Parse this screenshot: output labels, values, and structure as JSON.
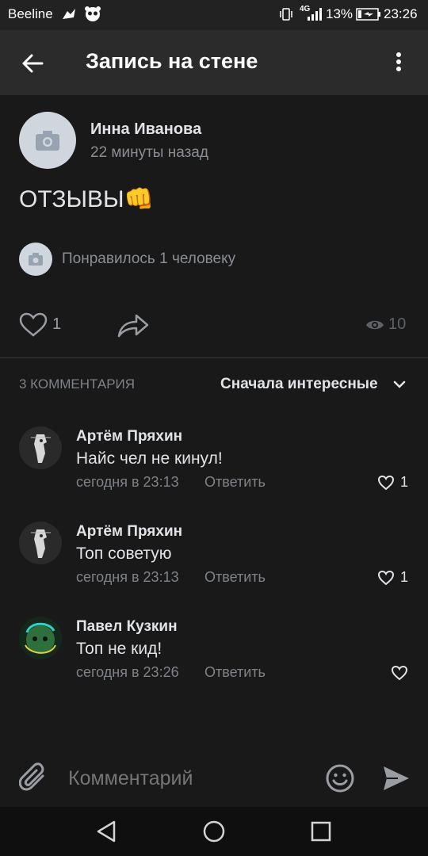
{
  "status_bar": {
    "carrier": "Beeline",
    "network": "4G",
    "battery": "13%",
    "time": "23:26"
  },
  "header": {
    "title": "Запись на стене"
  },
  "post": {
    "author": "Инна Иванова",
    "time": "22 минуты назад",
    "text": "ОТЗЫВЫ👊",
    "liked_by": "Понравилось 1 человеку",
    "likes": "1",
    "views": "10"
  },
  "comments_header": {
    "count_label": "3 КОММЕНТАРИЯ",
    "sort_label": "Сначала интересные"
  },
  "comments": [
    {
      "author": "Артём Пряхин",
      "text": "Найс чел не кинул!",
      "time": "сегодня в 23:13",
      "reply": "Ответить",
      "likes": "1"
    },
    {
      "author": "Артём Пряхин",
      "text": "Топ советую",
      "time": "сегодня в 23:13",
      "reply": "Ответить",
      "likes": "1"
    },
    {
      "author": "Павел Кузкин",
      "text": "Топ не кид!",
      "time": "сегодня в 23:26",
      "reply": "Ответить",
      "likes": ""
    }
  ],
  "composer": {
    "placeholder": "Комментарий"
  },
  "colors": {
    "background": "#19191a",
    "header": "#2b2b2c",
    "text": "#e1e3e6",
    "muted": "#7f8287",
    "accent_green": "#2f6f3c"
  }
}
